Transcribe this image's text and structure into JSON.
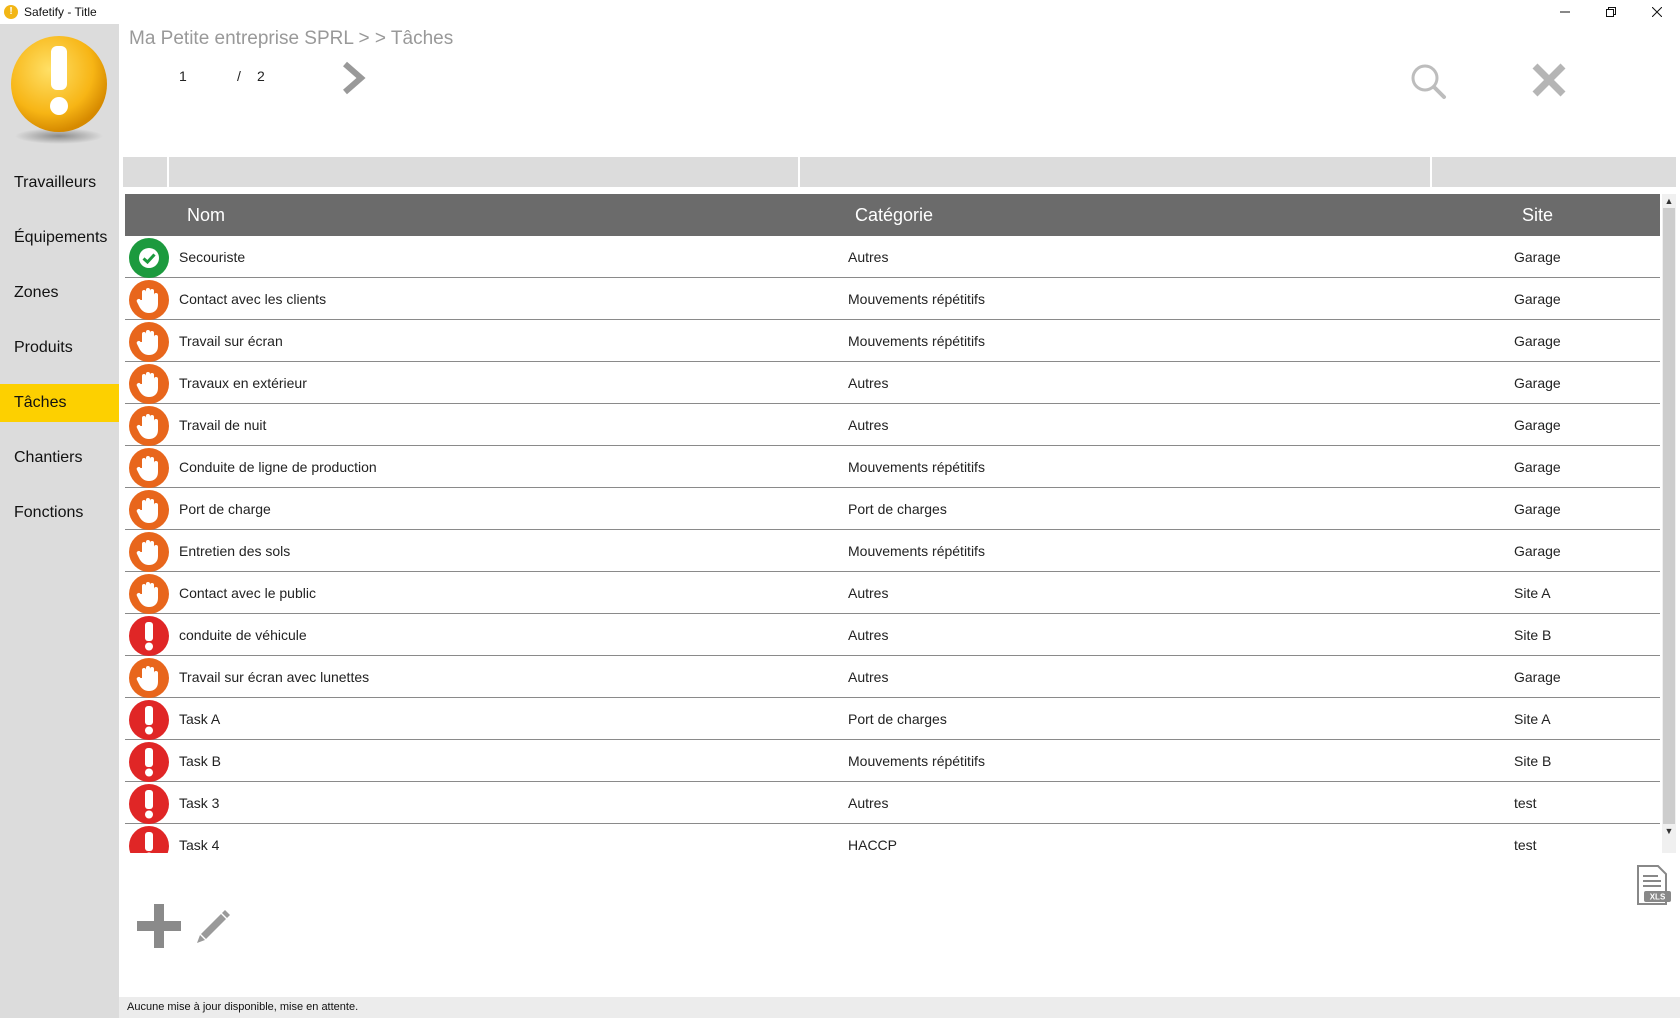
{
  "window": {
    "title": "Safetify - Title"
  },
  "sidebar": {
    "items": [
      {
        "label": "Travailleurs"
      },
      {
        "label": "Équipements"
      },
      {
        "label": "Zones"
      },
      {
        "label": "Produits"
      },
      {
        "label": "Tâches",
        "active": true
      },
      {
        "label": "Chantiers"
      },
      {
        "label": "Fonctions"
      }
    ]
  },
  "header": {
    "breadcrumb": "Ma Petite entreprise SPRL  > >  Tâches",
    "page_current": "1",
    "page_sep": "/",
    "page_total": "2"
  },
  "grid": {
    "columns": {
      "name": "Nom",
      "category": "Catégorie",
      "site": "Site"
    },
    "rows": [
      {
        "status": "ok",
        "name": "Secouriste",
        "category": "Autres",
        "site": "Garage"
      },
      {
        "status": "warn",
        "name": "Contact avec les clients",
        "category": "Mouvements répétitifs",
        "site": "Garage"
      },
      {
        "status": "warn",
        "name": "Travail sur écran",
        "category": "Mouvements répétitifs",
        "site": "Garage"
      },
      {
        "status": "warn",
        "name": "Travaux en extérieur",
        "category": "Autres",
        "site": "Garage"
      },
      {
        "status": "warn",
        "name": "Travail de nuit",
        "category": "Autres",
        "site": "Garage"
      },
      {
        "status": "warn",
        "name": "Conduite de ligne de production",
        "category": "Mouvements répétitifs",
        "site": "Garage"
      },
      {
        "status": "warn",
        "name": "Port de charge",
        "category": "Port de charges",
        "site": "Garage"
      },
      {
        "status": "warn",
        "name": "Entretien des sols",
        "category": "Mouvements répétitifs",
        "site": "Garage"
      },
      {
        "status": "warn",
        "name": "Contact avec le public",
        "category": "Autres",
        "site": "Site A"
      },
      {
        "status": "danger",
        "name": "conduite de véhicule",
        "category": "Autres",
        "site": "Site B"
      },
      {
        "status": "warn",
        "name": "Travail sur écran avec lunettes",
        "category": "Autres",
        "site": "Garage"
      },
      {
        "status": "danger",
        "name": "Task A",
        "category": "Port de charges",
        "site": "Site A"
      },
      {
        "status": "danger",
        "name": "Task B",
        "category": "Mouvements répétitifs",
        "site": "Site B"
      },
      {
        "status": "danger",
        "name": "Task 3",
        "category": "Autres",
        "site": "test"
      },
      {
        "status": "danger",
        "name": "Task 4",
        "category": "HACCP",
        "site": "test"
      }
    ]
  },
  "export": {
    "label": "XLS"
  },
  "statusbar": {
    "text": "Aucune mise à jour disponible, mise en attente."
  },
  "colors": {
    "accent": "#fdd000",
    "ok": "#1c9a3e",
    "warn": "#e8661c",
    "danger": "#e02626",
    "header": "#6b6b6b"
  }
}
